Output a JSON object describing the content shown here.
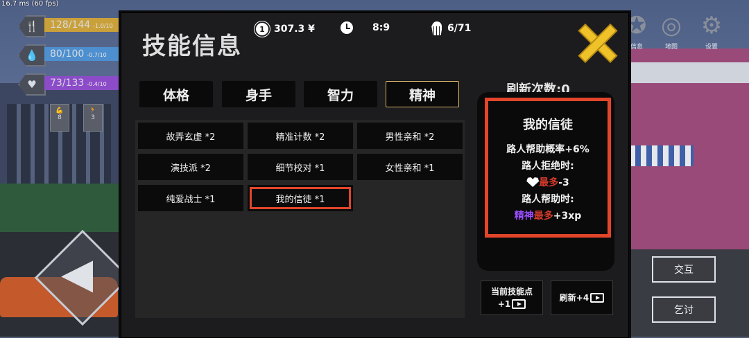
{
  "fps_text": "16.7 ms (60 fps)",
  "stats": [
    {
      "value": "128/144",
      "rate": "-1.0/10",
      "icon": "fork-knife-icon",
      "color": "#c9a03a"
    },
    {
      "value": "80/100",
      "rate": "-0.7/10",
      "icon": "water-drop-icon",
      "color": "#4d8fcf"
    },
    {
      "value": "73/133",
      "rate": "-0.4/10",
      "icon": "heart-pulse-icon",
      "color": "#8c4bc9"
    }
  ],
  "hud_skills": [
    {
      "icon": "muscle-icon",
      "value": "8"
    },
    {
      "icon": "running-icon",
      "value": "3"
    }
  ],
  "right_nav": [
    {
      "label": "信息",
      "icon": "info-icon"
    },
    {
      "label": "地图",
      "icon": "map-icon"
    },
    {
      "label": "设置",
      "icon": "gear-icon"
    }
  ],
  "side_buttons": {
    "interact": "交互",
    "beg": "乞讨"
  },
  "panel": {
    "title": "技能信息",
    "money": "307.3 ¥",
    "coin_glyph": "1",
    "time": "8:9",
    "food": "6/71",
    "tabs": [
      "体格",
      "身手",
      "智力",
      "精神"
    ],
    "active_tab": "精神",
    "skills": [
      "故弄玄虚 *2",
      "精准计数 *2",
      "男性亲和 *2",
      "演技派 *2",
      "细节校对 *1",
      "女性亲和 *1",
      "纯爱战士 *1",
      "我的信徒 *1"
    ],
    "selected_skill": "我的信徒 *1",
    "refresh_count": "刷新次数:0",
    "info": {
      "title": "我的信徒",
      "line1": "路人帮助概率+6%",
      "line2": "路人拒绝时:",
      "line3_red": "最多",
      "line3_rest": "-3",
      "line4": "路人帮助时:",
      "line5_purple": "精神",
      "line5_red": "最多",
      "line5_rest": "+3xp"
    },
    "skill_points_label": "当前技能点",
    "skill_points_value": "+1",
    "refresh_label": "刷新+4"
  }
}
